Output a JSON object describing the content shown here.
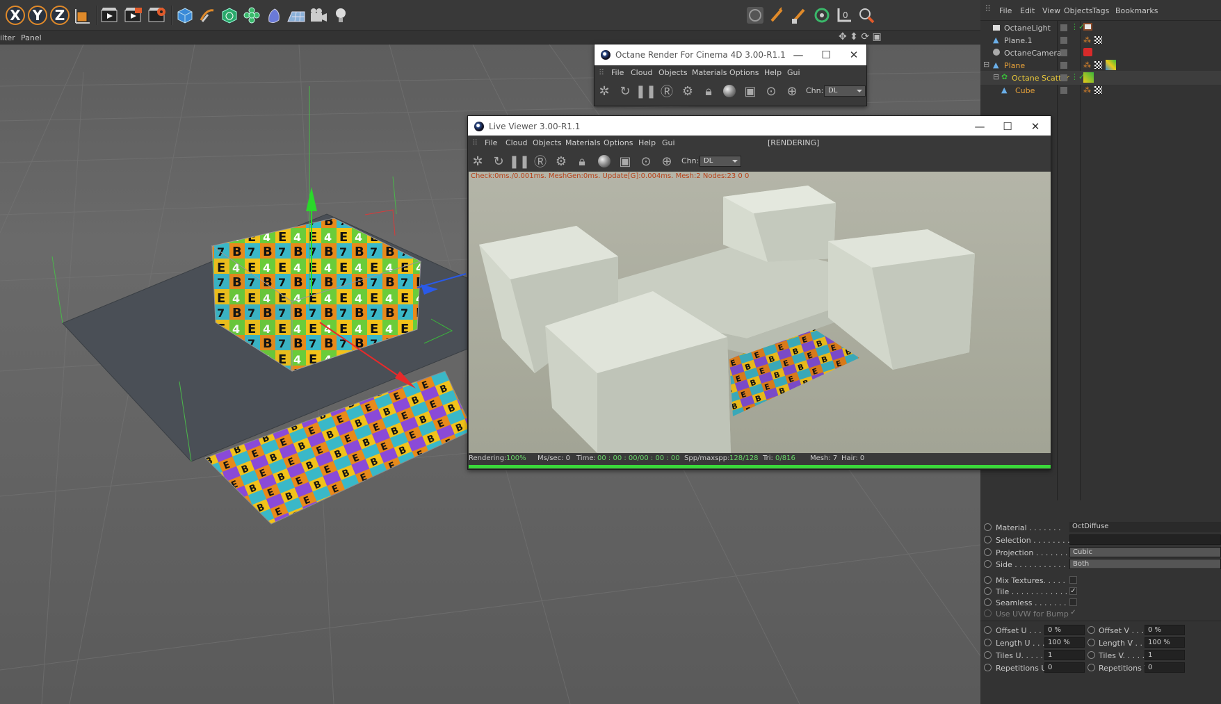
{
  "toolbar": {
    "axis_x": "X",
    "axis_y": "Y",
    "axis_z": "Z",
    "icons": [
      "coordinate-system-icon",
      "render-view-icon",
      "render-picture-viewer-icon",
      "edit-render-settings-icon",
      "cube-icon",
      "pen-icon",
      "subdivision-icon",
      "cloner-icon",
      "deformer-icon",
      "floor-icon",
      "camera-icon",
      "light-icon"
    ],
    "right_icons": [
      "live-selection-icon",
      "move-icon",
      "scale-icon",
      "rotate-icon",
      "workplane-icon",
      "snap-icon"
    ]
  },
  "viewport_menu": {
    "filter": "ilter",
    "panel": "Panel"
  },
  "object_manager": {
    "menu": [
      "File",
      "Edit",
      "View",
      "Objects",
      "Tags",
      "Bookmarks"
    ],
    "objects": [
      {
        "name": "OctaneLight",
        "color": "#c8c8c8"
      },
      {
        "name": "Plane.1",
        "color": "#c8c8c8"
      },
      {
        "name": "OctaneCamera",
        "color": "#c8c8c8"
      },
      {
        "name": "Plane",
        "color": "#e8a23a"
      },
      {
        "name": "Octane Scatter",
        "color": "#e8c83a"
      },
      {
        "name": "Cube",
        "color": "#e8a23a"
      }
    ]
  },
  "octane_window": {
    "title": "Octane Render For Cinema 4D 3.00-R1.1",
    "menu": [
      "File",
      "Cloud",
      "Objects",
      "Materials",
      "Options",
      "Help",
      "Gui"
    ],
    "chn_label": "Chn:",
    "chn_value": "DL"
  },
  "live_viewer": {
    "title": "Live Viewer 3.00-R1.1",
    "menu": [
      "File",
      "Cloud",
      "Objects",
      "Materials",
      "Options",
      "Help",
      "Gui"
    ],
    "status": "[RENDERING]",
    "chn_label": "Chn:",
    "chn_value": "DL",
    "check_line": "Check:0ms./0.001ms. MeshGen:0ms. Update[G]:0.004ms. Mesh:2 Nodes:23  0 0",
    "footer": {
      "rendering_label": "Rendering:",
      "rendering_value": "100%",
      "mssec": "Ms/sec: 0",
      "time_label": "Time:",
      "time_value": "00 : 00 : 00/00 : 00 : 00",
      "spp_label": "Spp/maxspp:",
      "spp_value": "128/128",
      "tri_label": "Tri:",
      "tri_value": "0/816",
      "mesh": "Mesh: 7",
      "hair": "Hair: 0"
    },
    "progress": 1.0
  },
  "attributes": {
    "material_label": "Material . . . . . . .",
    "material_value": "OctDiffuse",
    "selection_label": "Selection . . . . . . . .",
    "projection_label": "Projection . . . . . . .",
    "projection_value": "Cubic",
    "side_label": "Side . . . . . . . . . . .",
    "side_value": "Both",
    "mix_textures_label": "Mix Textures. . . . .",
    "tile_label": "Tile . . . . . . . . . . . .",
    "seamless_label": "Seamless . . . . . . .",
    "uvw_label": "Use UVW for Bump",
    "offset_u_label": "Offset U . . . .",
    "offset_u_value": "0 %",
    "offset_v_label": "Offset V . . . .",
    "offset_v_value": "0 %",
    "length_u_label": "Length U . . .",
    "length_u_value": "100 %",
    "length_v_label": "Length V . . .",
    "length_v_value": "100 %",
    "tiles_u_label": "Tiles U. . . . .",
    "tiles_u_value": "1",
    "tiles_v_label": "Tiles V. . . . .",
    "tiles_v_value": "1",
    "rep_u_label": "Repetitions U",
    "rep_u_value": "0",
    "rep_v_label": "Repetitions V",
    "rep_v_value": "0"
  }
}
